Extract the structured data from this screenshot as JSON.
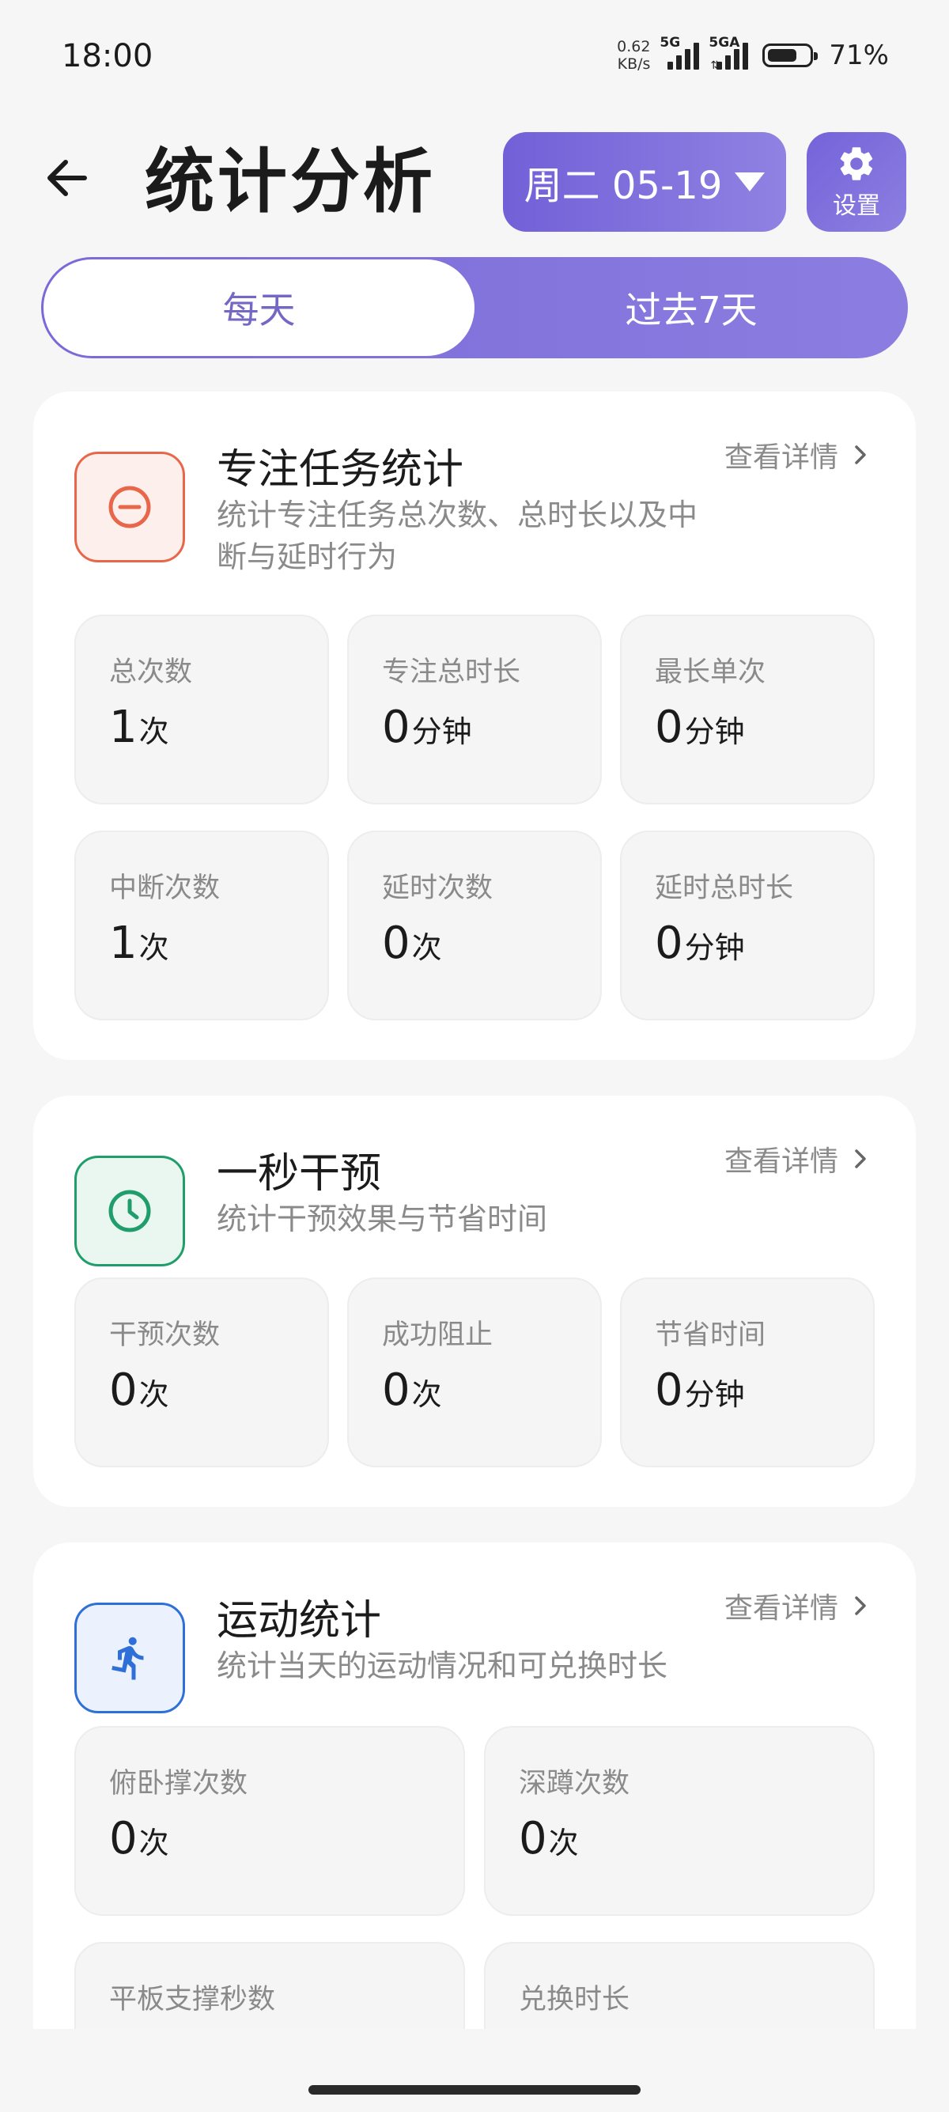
{
  "status_bar": {
    "time": "18:00",
    "net_speed_value": "0.62",
    "net_speed_unit": "KB/s",
    "sim1_label": "5G",
    "sim2_label": "5GA",
    "battery_percent": "71%",
    "battery_level": 0.71
  },
  "header": {
    "title": "统计分析",
    "date_label": "周二 05-19",
    "settings_label": "设置"
  },
  "tabs": [
    {
      "label": "每天",
      "selected": true
    },
    {
      "label": "过去7天",
      "selected": false
    }
  ],
  "cards": {
    "focus": {
      "title": "专注任务统计",
      "description": "统计专注任务总次数、总时长以及中断与延时行为",
      "detail_label": "查看详情",
      "icon": "minus-circle-icon",
      "color": "#e8674a",
      "stats": [
        {
          "label": "总次数",
          "value": "1",
          "unit": "次"
        },
        {
          "label": "专注总时长",
          "value": "0",
          "unit": "分钟"
        },
        {
          "label": "最长单次",
          "value": "0",
          "unit": "分钟"
        },
        {
          "label": "中断次数",
          "value": "1",
          "unit": "次"
        },
        {
          "label": "延时次数",
          "value": "0",
          "unit": "次"
        },
        {
          "label": "延时总时长",
          "value": "0",
          "unit": "分钟"
        }
      ]
    },
    "intervention": {
      "title": "一秒干预",
      "description": "统计干预效果与节省时间",
      "detail_label": "查看详情",
      "icon": "clock-icon",
      "color": "#1f9d6b",
      "stats": [
        {
          "label": "干预次数",
          "value": "0",
          "unit": "次"
        },
        {
          "label": "成功阻止",
          "value": "0",
          "unit": "次"
        },
        {
          "label": "节省时间",
          "value": "0",
          "unit": "分钟"
        }
      ]
    },
    "exercise": {
      "title": "运动统计",
      "description": "统计当天的运动情况和可兑换时长",
      "detail_label": "查看详情",
      "icon": "running-icon",
      "color": "#2f6fd8",
      "stats": [
        {
          "label": "俯卧撑次数",
          "value": "0",
          "unit": "次"
        },
        {
          "label": "深蹲次数",
          "value": "0",
          "unit": "次"
        },
        {
          "label": "平板支撑秒数"
        },
        {
          "label": "兑换时长"
        }
      ]
    }
  }
}
